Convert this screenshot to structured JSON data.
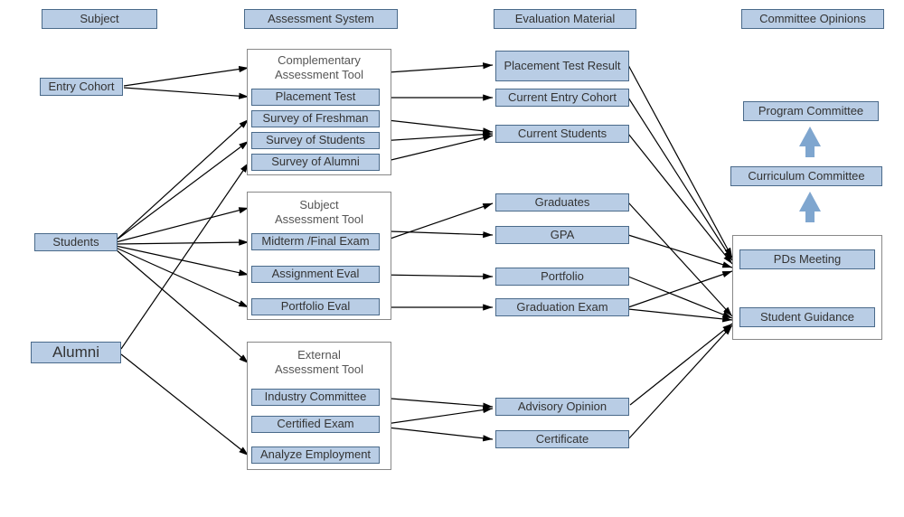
{
  "columns": {
    "subject": "Subject",
    "assessment": "Assessment  System",
    "material": "Evaluation Material",
    "opinions": "Committee Opinions"
  },
  "subjects": {
    "entry": "Entry Cohort",
    "students": "Students",
    "alumni": "Alumni"
  },
  "tools": {
    "comp": {
      "title": "Complementary\nAssessment Tool",
      "placement": "Placement Test",
      "freshman": "Survey of  Freshman",
      "students": "Survey of Students",
      "alumni": "Survey of Alumni"
    },
    "subj": {
      "title": "Subject\nAssessment Tool",
      "midterm": "Midterm /Final Exam",
      "assignment": "Assignment Eval",
      "portfolio": "Portfolio Eval"
    },
    "ext": {
      "title": "External\nAssessment Tool",
      "industry": "Industry Committee",
      "certified": "Certified Exam",
      "analyze": "Analyze Employment"
    }
  },
  "materials": {
    "placement": "Placement Test Result",
    "entry": "Current Entry Cohort",
    "students": "Current Students",
    "graduates": "Graduates",
    "gpa": "GPA",
    "portfolio": "Portfolio",
    "gradexam": "Graduation Exam",
    "advisory": "Advisory Opinion",
    "certificate": "Certificate"
  },
  "committees": {
    "program": "Program Committee",
    "curriculum": "Curriculum Committee",
    "pds": "PDs Meeting",
    "guidance": "Student Guidance"
  }
}
